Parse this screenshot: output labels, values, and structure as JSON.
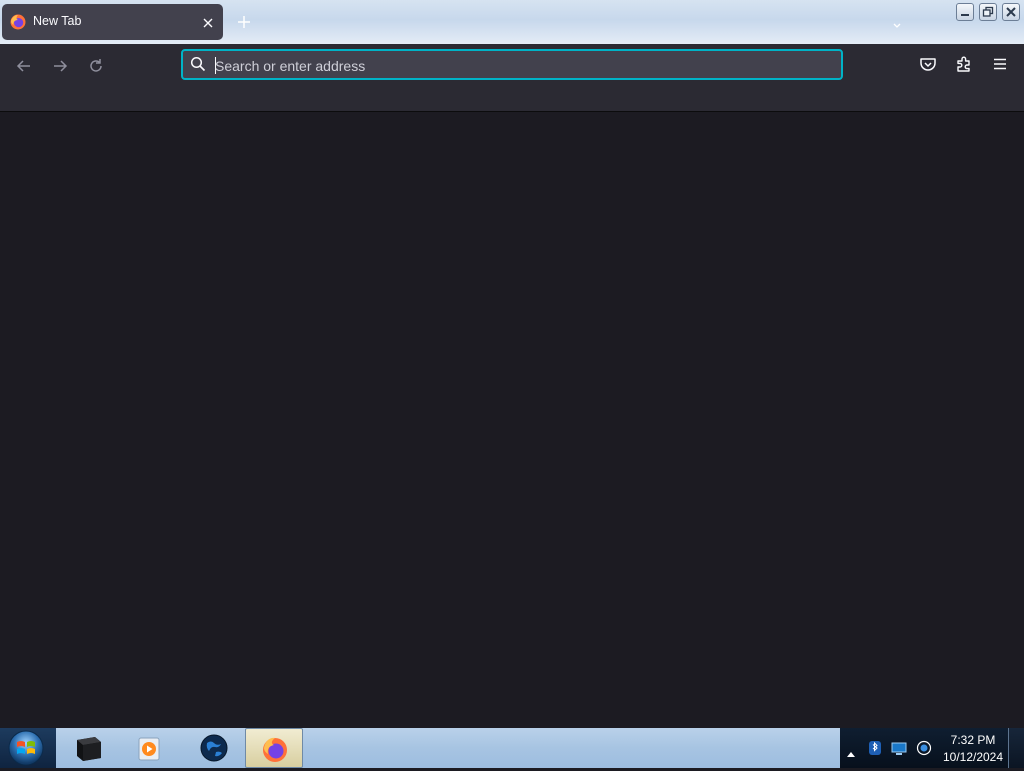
{
  "window": {
    "tabs": [
      {
        "title": "New Tab",
        "icon": "firefox-icon",
        "active": true
      }
    ],
    "controls": [
      "minimize-icon",
      "restore-icon",
      "close-icon"
    ]
  },
  "toolbar": {
    "nav_icons": [
      "back-arrow-icon",
      "forward-arrow-icon",
      "reload-icon"
    ],
    "urlbar": {
      "placeholder": "Search or enter address",
      "value": "",
      "icon": "search-icon"
    },
    "right_icons": [
      "pocket-icon",
      "extensions-icon",
      "hamburger-menu-icon"
    ]
  },
  "taskbar": {
    "start_icon": "windows-start-icon",
    "pinned": [
      "terminal-icon",
      "media-player-icon",
      "globe-icon",
      "firefox-icon"
    ],
    "active_pinned": "firefox-icon",
    "tray_icons": [
      "show-hidden-icons-arrow",
      "bluetooth-icon",
      "network-icon",
      "sync-icon"
    ],
    "clock": {
      "time": "7:32 PM",
      "date": "10/12/2024"
    }
  },
  "colors": {
    "accent": "#00b3c7",
    "toolbar_bg": "#2b2a33",
    "content_bg": "#1c1b22",
    "tab_bg": "#42414d"
  }
}
